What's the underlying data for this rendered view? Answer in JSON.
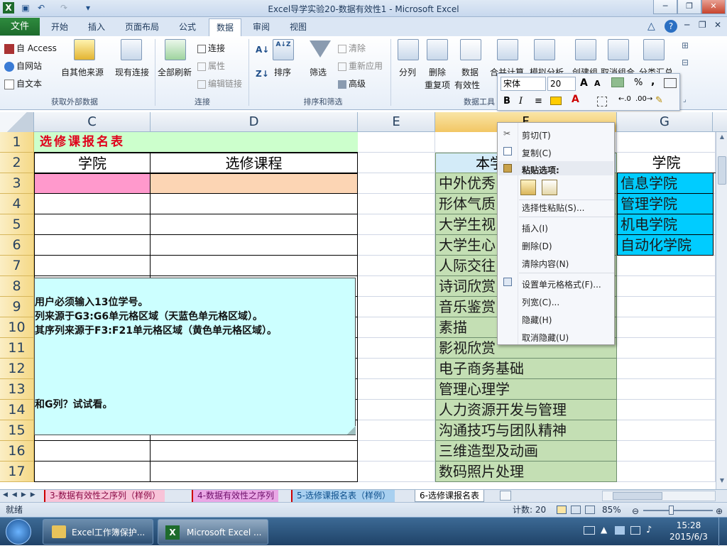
{
  "window": {
    "title": "Excel导学实验20-数据有效性1 - Microsoft Excel"
  },
  "ribbon_tabs": {
    "file": "文件",
    "items": [
      "开始",
      "插入",
      "页面布局",
      "公式",
      "数据",
      "审阅",
      "视图"
    ],
    "active": "数据"
  },
  "ribbon": {
    "get_external": {
      "access": "自 Access",
      "web": "自网站",
      "text": "自文本",
      "other": "自其他来源",
      "existing": "现有连接",
      "label": "获取外部数据"
    },
    "connections": {
      "refresh_all": "全部刷新",
      "connect": "连接",
      "properties": "属性",
      "edit_links": "编辑链接",
      "label": "连接"
    },
    "sort_filter": {
      "sort": "排序",
      "filter": "筛选",
      "clear": "清除",
      "reapply": "重新应用",
      "advanced": "高级",
      "label": "排序和筛选",
      "az": "A↓Z",
      "sort_az": "A↓",
      "sort_za": "Z↓"
    },
    "data_tools": {
      "split": "分列",
      "remove_dup_1": "删除",
      "remove_dup_2": "重复项",
      "validation_1": "数据",
      "validation_2": "有效性",
      "consolidate": "合并计算",
      "whatif": "模拟分析",
      "label": "数据工具"
    },
    "outline": {
      "group": "创建组",
      "ungroup": "取消组合",
      "subtotal": "分类汇总"
    }
  },
  "mini_toolbar": {
    "font": "宋体",
    "size": "20",
    "bold": "B",
    "italic": "I",
    "align": "≡",
    "percent": "%",
    "comma": ",",
    "grow": "A",
    "shrink": "A"
  },
  "columns": [
    "C",
    "D",
    "E",
    "F",
    "G"
  ],
  "rows": [
    "1",
    "2",
    "3",
    "4",
    "5",
    "6",
    "7",
    "8",
    "9",
    "10",
    "11",
    "12",
    "13",
    "14",
    "15",
    "16",
    "17"
  ],
  "sheet": {
    "title": "选修课报名表",
    "header_college": "学院",
    "header_course": "选修课程",
    "f_header": "本学",
    "g_header": "学院",
    "f_values": [
      "中外优秀",
      "形体气质",
      "大学生视",
      "大学生心",
      "人际交往",
      "诗词欣赏",
      "音乐鉴赏",
      "素描",
      "影视欣赏",
      "电子商务基础",
      "管理心理学",
      "人力资源开发与管理",
      "沟通技巧与团队精神",
      "三维造型及动画",
      "数码照片处理"
    ],
    "g_values": [
      "信息学院",
      "管理学院",
      "机电学院",
      "自动化学院"
    ],
    "colors": {
      "title_bg": "#ccffcc",
      "pink": "#ff99cc",
      "orange": "#fcd5b4",
      "green": "#c4dfb4",
      "cyan": "#00ccff",
      "title_text": "#e0001b"
    }
  },
  "comment": {
    "line1": "用户必须输入13位学号。",
    "line2": "列来源于G3:G6单元格区域（天蓝色单元格区域）。",
    "line3": "其序列来源于F3:F21单元格区域（黄色单元格区域）。",
    "line4": "和G列？试试看。"
  },
  "context_menu": {
    "cut": "剪切(T)",
    "copy": "复制(C)",
    "paste_options": "粘贴选项:",
    "paste_special": "选择性粘贴(S)...",
    "insert": "插入(I)",
    "delete": "删除(D)",
    "clear": "清除内容(N)",
    "format": "设置单元格格式(F)...",
    "width": "列宽(C)...",
    "hide": "隐藏(H)",
    "unhide": "取消隐藏(U)"
  },
  "sheet_tabs": [
    "3-数据有效性之序列（样例）",
    "4-数据有效性之序列",
    "5-选修课报名表（样例）",
    "6-选修课报名表"
  ],
  "status": {
    "ready": "就绪",
    "count": "计数: 20",
    "zoom": "85%"
  },
  "taskbar": {
    "item1": "Excel工作簿保护...",
    "item2": "Microsoft Excel ...",
    "time": "15:28",
    "date": "2015/6/3"
  }
}
